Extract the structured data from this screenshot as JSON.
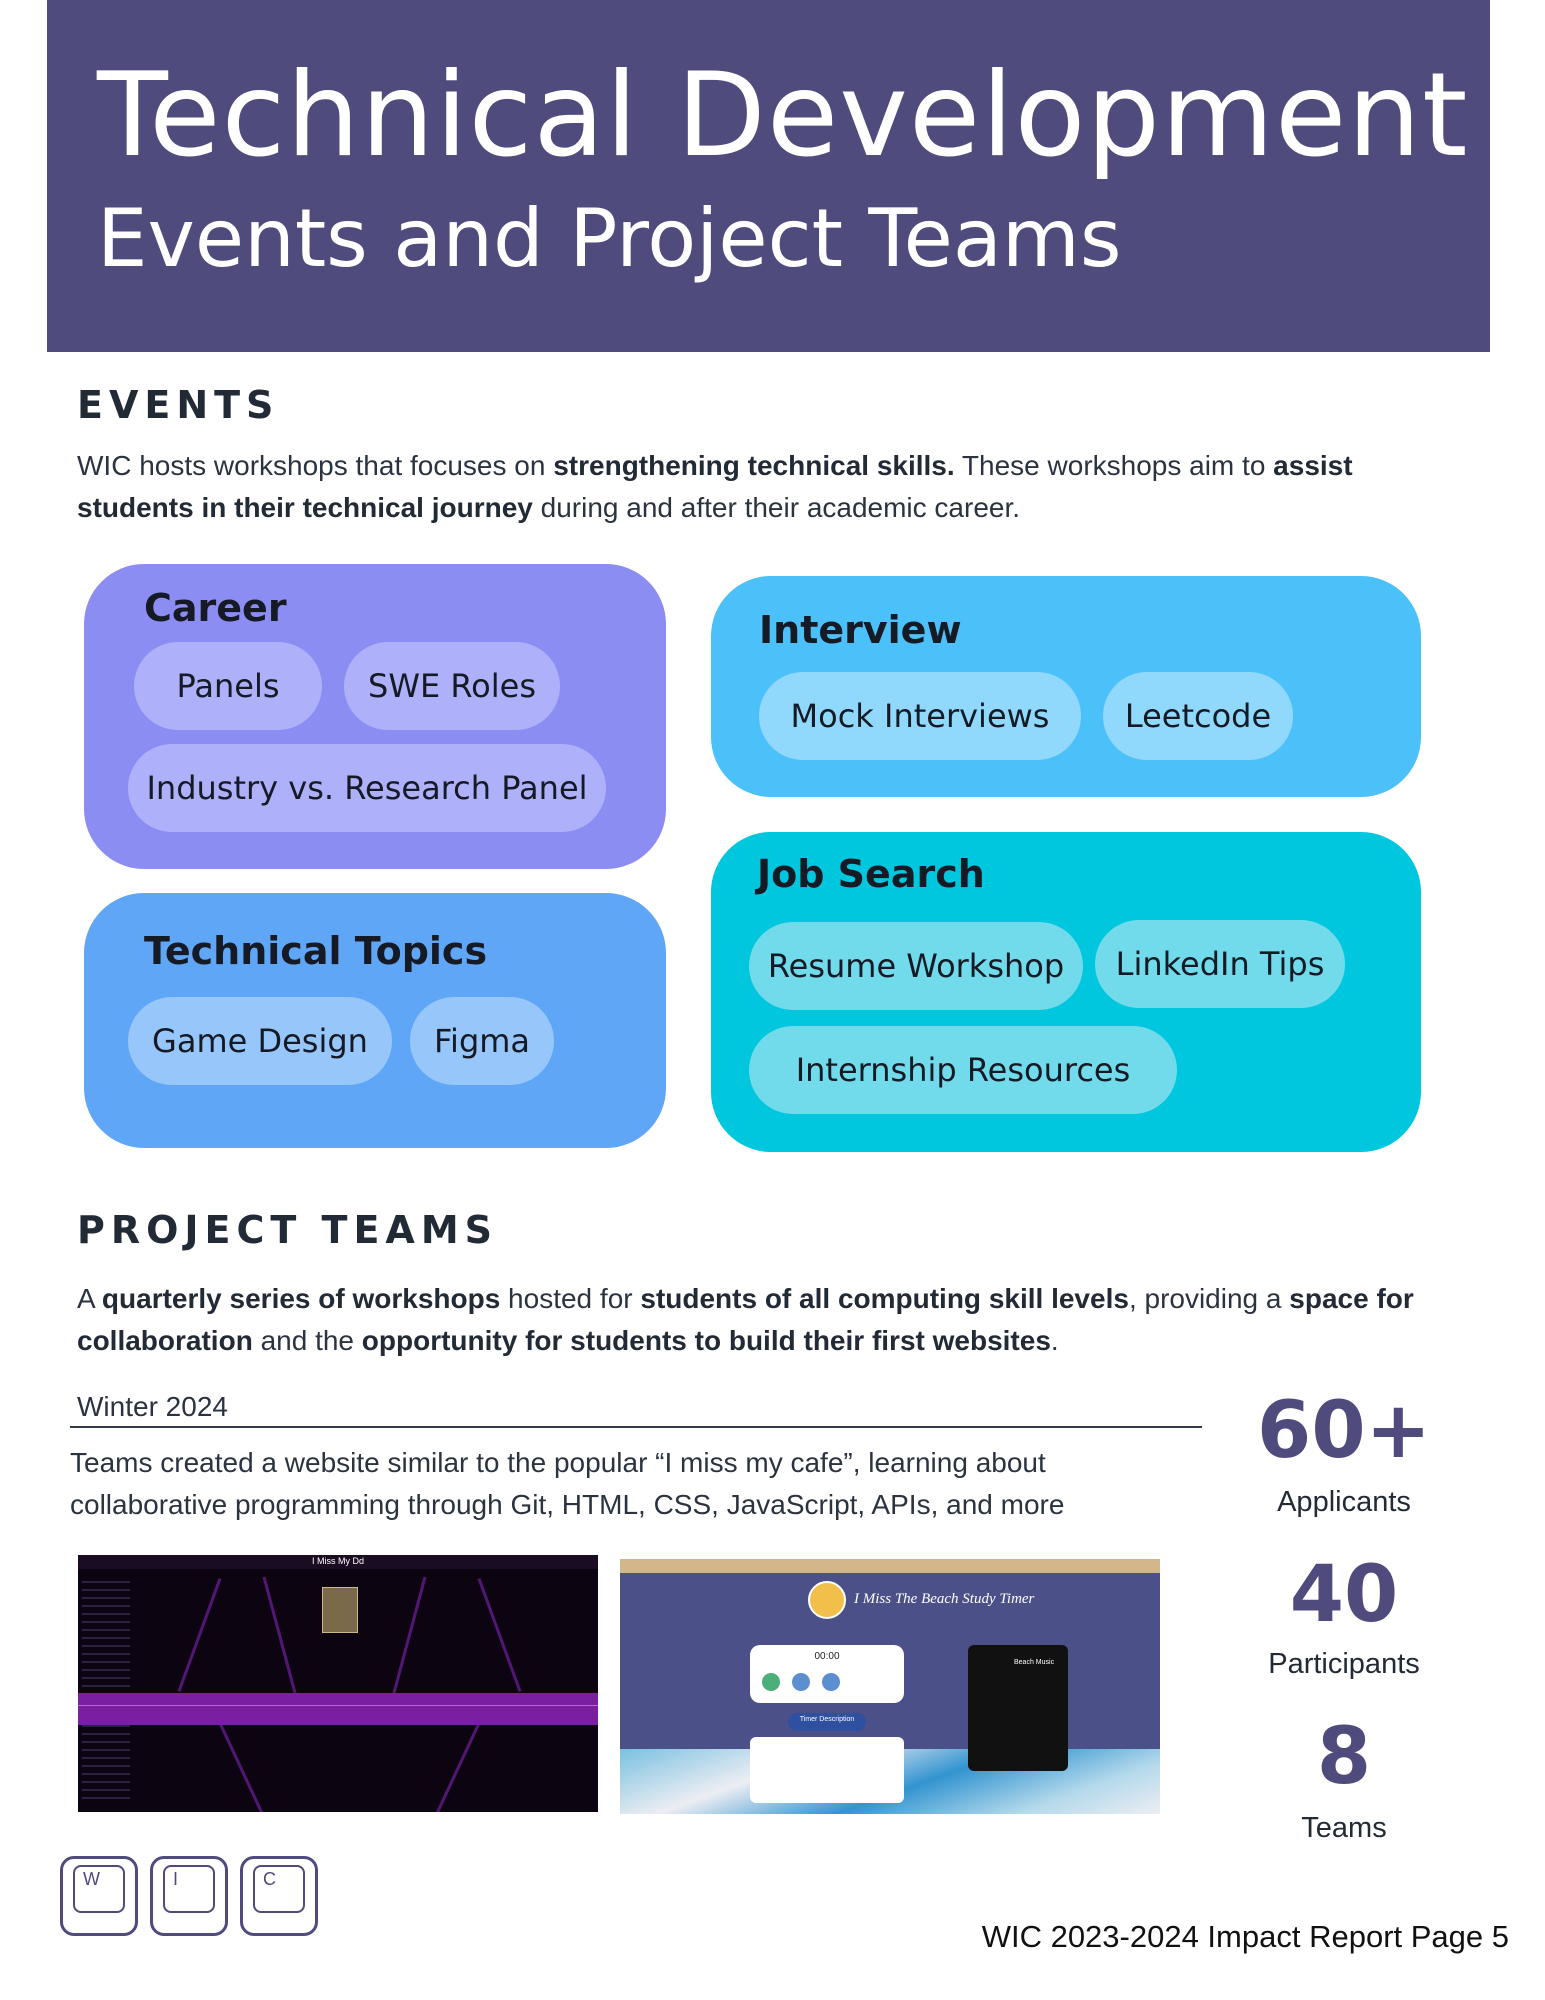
{
  "header": {
    "title": "Technical Development",
    "subtitle": "Events and Project Teams"
  },
  "events": {
    "heading": "EVENTS",
    "intro_parts": {
      "p1": "WIC hosts workshops that focuses on ",
      "b1": "strengthening technical skills.",
      "p2": " These workshops aim to ",
      "b2": "assist students in their technical journey",
      "p3": " during and after their academic career."
    },
    "cards": {
      "career": {
        "title": "Career",
        "items": [
          "Panels",
          "SWE Roles",
          "Industry vs. Research Panel"
        ]
      },
      "technical": {
        "title": "Technical Topics",
        "items": [
          "Game Design",
          "Figma"
        ]
      },
      "interview": {
        "title": "Interview",
        "items": [
          "Mock Interviews",
          "Leetcode"
        ]
      },
      "job_search": {
        "title": "Job Search",
        "items": [
          "Resume Workshop",
          "LinkedIn Tips",
          "Internship Resources"
        ]
      }
    }
  },
  "project_teams": {
    "heading": "PROJECT TEAMS",
    "intro_parts": {
      "p1": "A ",
      "b1": "quarterly series of workshops",
      "p2": " hosted for ",
      "b2": "students of all computing skill levels",
      "p3": ", providing a ",
      "b3": "space for collaboration",
      "p4": " and the ",
      "b4": "opportunity for students to build their first websites",
      "p5": "."
    },
    "winter": {
      "label": "Winter 2024",
      "description": "Teams created a website similar to the popular “I miss my cafe”, learning about collaborative programming through Git, HTML, CSS, JavaScript, APIs, and more"
    },
    "screenshots": {
      "one_title": "I Miss My Dd",
      "two_title": "I Miss The Beach Study Timer",
      "two_timer": "00:00",
      "two_button": "Timer Description",
      "two_music": "Beach Music"
    },
    "stats": [
      {
        "value": "60+",
        "label": "Applicants"
      },
      {
        "value": "40",
        "label": "Participants"
      },
      {
        "value": "8",
        "label": "Teams"
      }
    ]
  },
  "logo": {
    "letters": [
      "W",
      "I",
      "C"
    ]
  },
  "footer": {
    "text": "WIC 2023-2024 Impact Report Page 5"
  },
  "colors": {
    "header_bg": "#4f4b7c",
    "career": "#8b8df3",
    "technical": "#60a6f6",
    "interview": "#4cc0f8",
    "job_search": "#00c7de"
  }
}
